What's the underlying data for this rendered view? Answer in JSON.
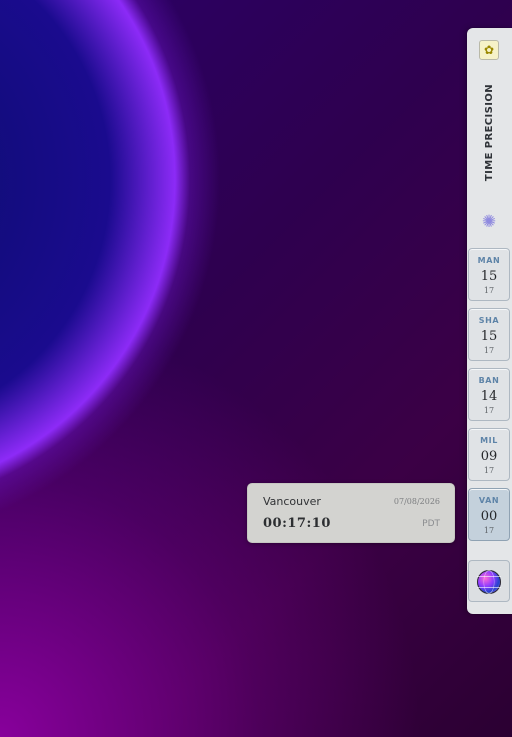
{
  "panel": {
    "title": "TIME PRECISION",
    "app_icon": "flower-app-icon",
    "settings_icon": "gear-icon",
    "globe_icon": "globe-icon"
  },
  "cities": [
    {
      "code": "MAN",
      "hour": "15",
      "minute": "17",
      "active": false
    },
    {
      "code": "SHA",
      "hour": "15",
      "minute": "17",
      "active": false
    },
    {
      "code": "BAN",
      "hour": "14",
      "minute": "17",
      "active": false
    },
    {
      "code": "MIL",
      "hour": "09",
      "minute": "17",
      "active": false
    },
    {
      "code": "VAN",
      "hour": "00",
      "minute": "17",
      "active": true
    }
  ],
  "tooltip": {
    "city": "Vancouver",
    "date": "07/08/2026",
    "time": "00:17:10",
    "timezone": "PDT"
  },
  "colors": {
    "accent_blue": "#5e84a8",
    "active_tile": "#c4d1dc",
    "panel_bg": "#e4e6e8"
  }
}
